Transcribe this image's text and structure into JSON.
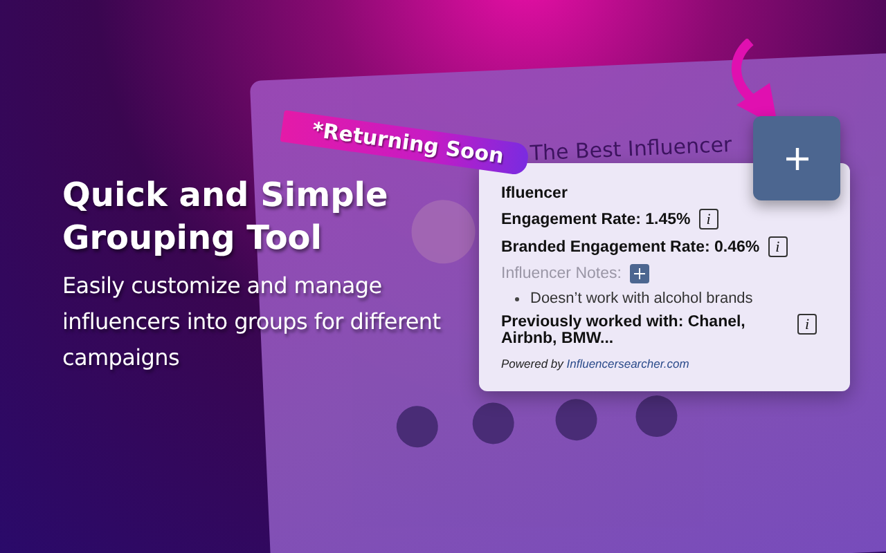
{
  "browser": {
    "profile_name": "The Best Influencer"
  },
  "headline": "Quick and Simple Grouping Tool",
  "subtitle": "Easily customize and manage influencers into groups for different campaigns",
  "ribbon": "*Returning Soon",
  "card": {
    "title": "Ifluencer",
    "metrics": [
      {
        "text": "Engagement Rate: 1.45%",
        "info": "i"
      },
      {
        "text": "Branded Engagement Rate: 0.46%",
        "info": "i"
      }
    ],
    "notes": {
      "label": "Influencer Notes:",
      "items": [
        "Doesn’t work with alcohol brands"
      ]
    },
    "previous": {
      "text": "Previously worked with: Chanel,  Airbnb, BMW...",
      "info": "i"
    },
    "powered_by": {
      "prefix": "Powered by",
      "link": "Influencersearcher.com"
    }
  }
}
